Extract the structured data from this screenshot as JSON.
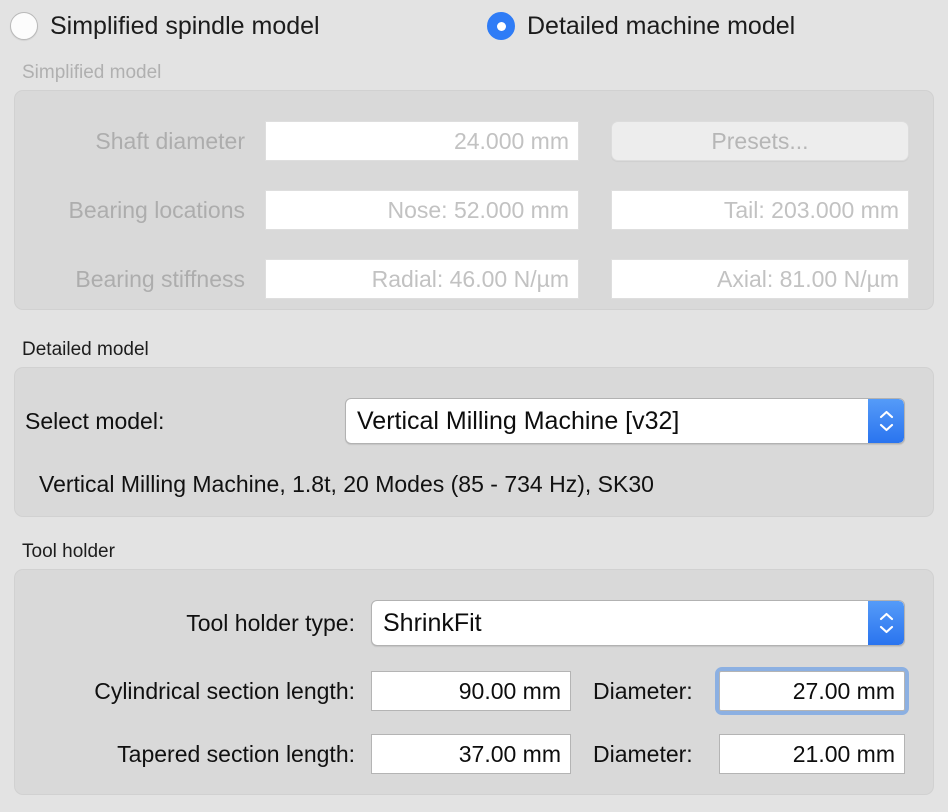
{
  "model_choice": {
    "options": [
      {
        "label": "Simplified spindle model",
        "selected": false
      },
      {
        "label": "Detailed machine model",
        "selected": true
      }
    ]
  },
  "simplified_model": {
    "header": "Simplified model",
    "enabled": false,
    "shaft_diameter": {
      "label": "Shaft diameter",
      "value": "24.000 mm"
    },
    "presets_button": "Presets...",
    "bearing_locations": {
      "label": "Bearing locations",
      "nose": "Nose:  52.000 mm",
      "tail": "Tail:  203.000 mm"
    },
    "bearing_stiffness": {
      "label": "Bearing stiffness",
      "radial": "Radial:  46.00 N/µm",
      "axial": "Axial:  81.00 N/µm"
    }
  },
  "detailed_model": {
    "header": "Detailed model",
    "select_label": "Select model:",
    "selected_model": "Vertical Milling Machine [v32]",
    "description": "Vertical Milling Machine, 1.8t, 20 Modes (85 - 734 Hz), SK30"
  },
  "tool_holder": {
    "header": "Tool holder",
    "type_label": "Tool holder type:",
    "type_value": "ShrinkFit",
    "cylindrical": {
      "label": "Cylindrical section length:",
      "length": "90.00 mm",
      "diameter_label": "Diameter:",
      "diameter": "27.00 mm",
      "diameter_focused": true
    },
    "tapered": {
      "label": "Tapered section length:",
      "length": "37.00 mm",
      "diameter_label": "Diameter:",
      "diameter": "21.00 mm"
    }
  },
  "colors": {
    "page_background": "#e3e3e3",
    "group_background": "#d9d9d9",
    "accent_blue": "#2f7cf6",
    "focus_ring": "#8cb0e2",
    "disabled_text": "#b0b0b0",
    "enabled_text": "#101010"
  }
}
